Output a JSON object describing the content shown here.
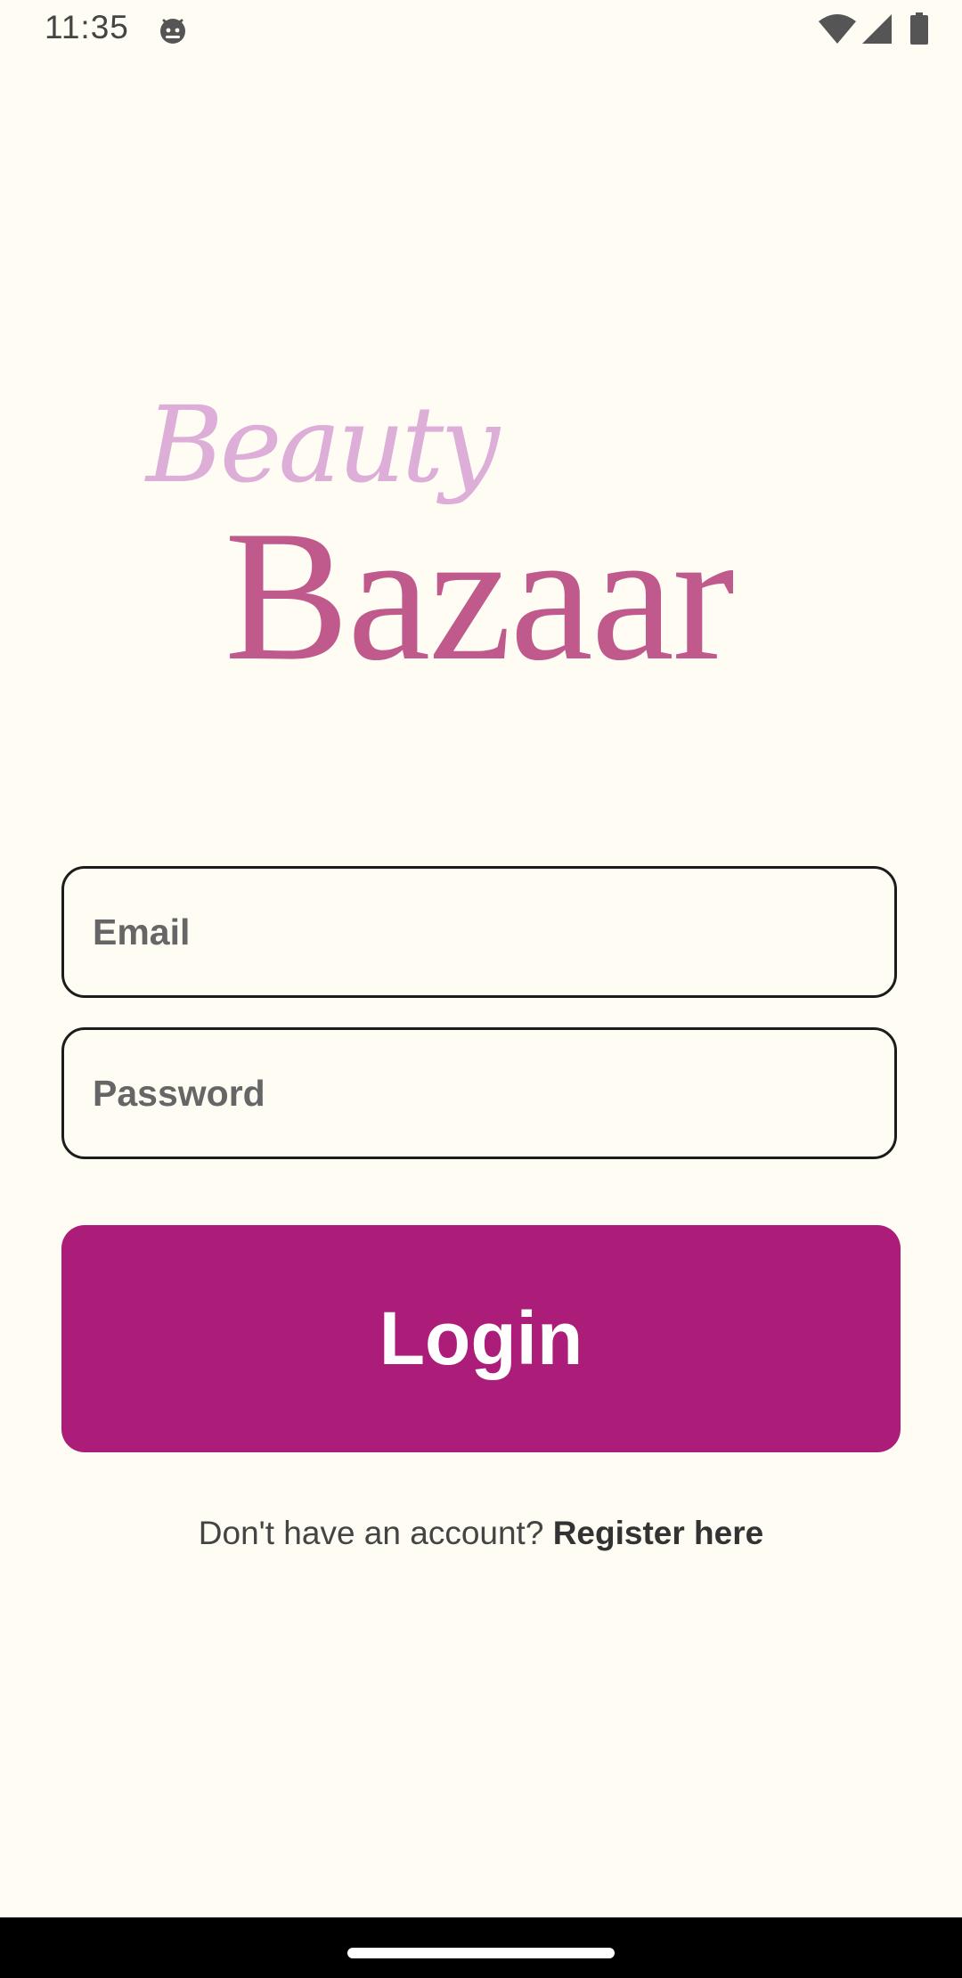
{
  "status_bar": {
    "time": "11:35",
    "app_icon": "android-face-icon",
    "wifi_icon": "wifi-icon",
    "signal_icon": "cellular-signal-icon",
    "battery_icon": "battery-icon"
  },
  "logo": {
    "line1": "Beauty",
    "line2": "Bazaar",
    "colors": {
      "beauty": "#dcaed8",
      "bazaar": "#c05a8d"
    }
  },
  "form": {
    "email_placeholder": "Email",
    "email_value": "",
    "password_placeholder": "Password",
    "password_value": "",
    "login_label": "Login"
  },
  "register": {
    "prompt": "Don't have an account? ",
    "link_label": "Register here"
  },
  "theme": {
    "background": "#fffdf3",
    "accent": "#ab1d79"
  }
}
